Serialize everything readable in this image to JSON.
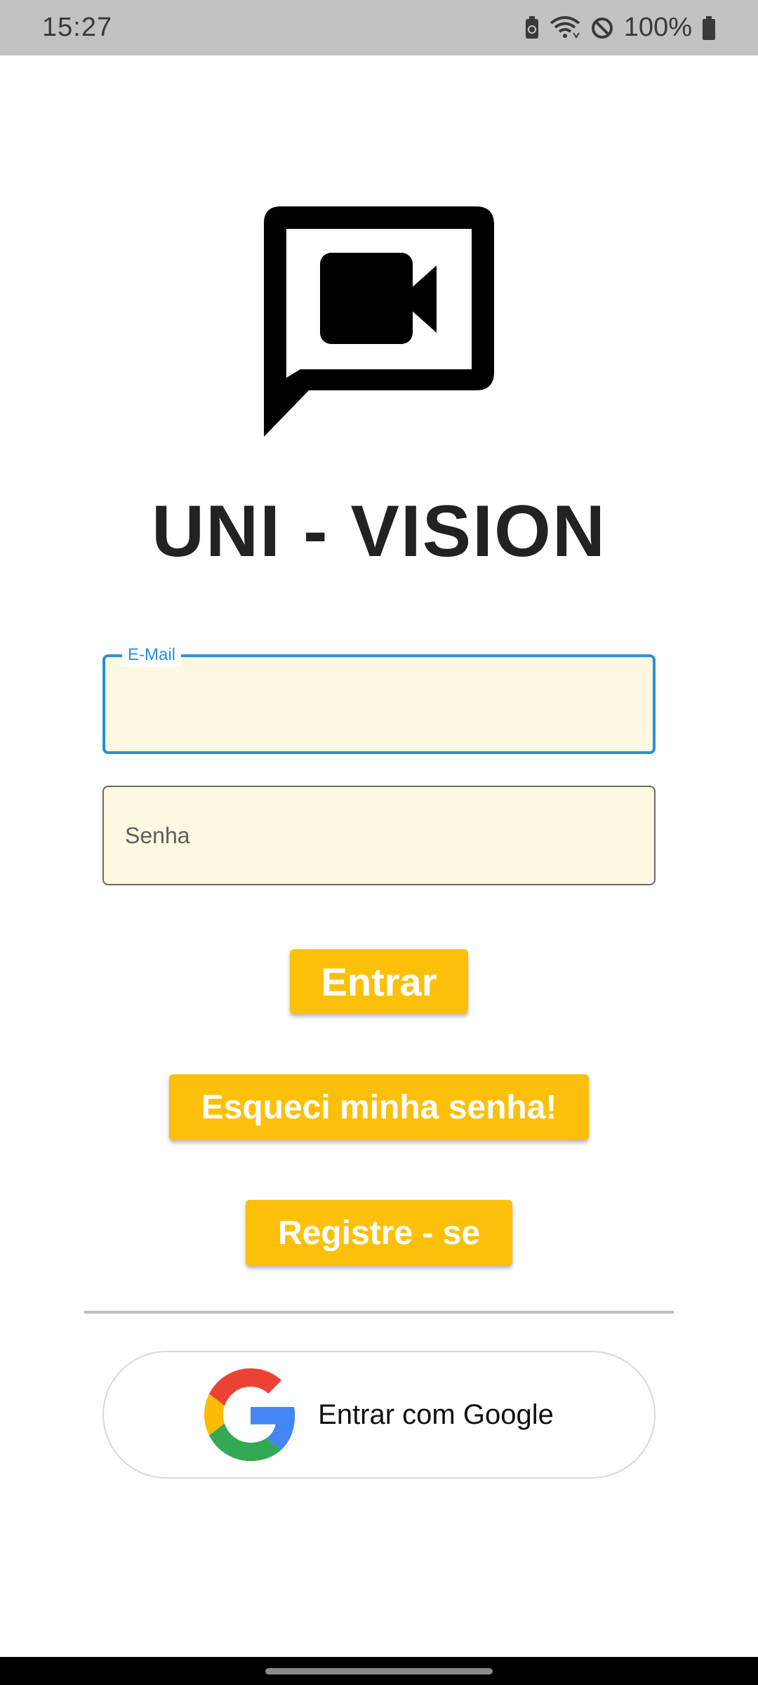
{
  "status_bar": {
    "time": "15:27",
    "battery_percent": "100%",
    "icons": [
      "battery-saver-icon",
      "wifi-icon",
      "do-not-disturb-icon",
      "battery-icon"
    ]
  },
  "app": {
    "logo_icon": "video-chat-icon",
    "title": "UNI - VISION"
  },
  "form": {
    "email_label": "E-Mail",
    "email_value": "",
    "password_placeholder": "Senha"
  },
  "buttons": {
    "login": "Entrar",
    "forgot": "Esqueci minha senha!",
    "register": "Registre - se",
    "google": "Entrar com Google"
  },
  "colors": {
    "accent_yellow": "#fcc00a",
    "focus_blue": "#2b8fd9",
    "field_background": "#fcf8e1"
  }
}
